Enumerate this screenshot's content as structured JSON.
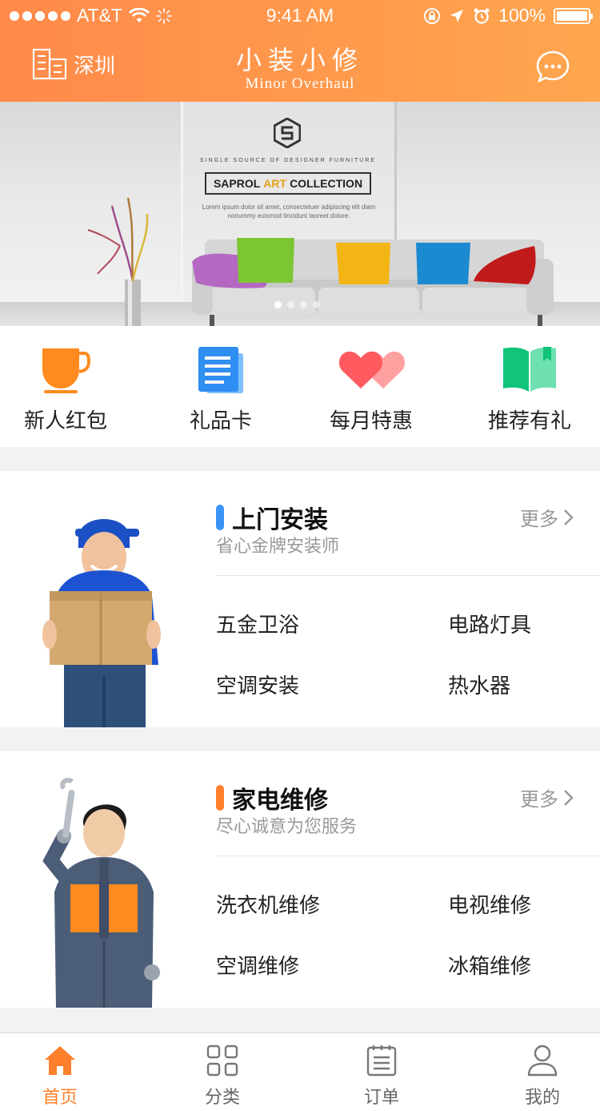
{
  "status_bar": {
    "carrier": "AT&T",
    "time": "9:41 AM",
    "battery": "100%"
  },
  "header": {
    "city": "深圳",
    "brand_cn": "小装小修",
    "brand_en": "Minor Overhaul",
    "brand_color": "#ff8a4a"
  },
  "banner": {
    "tagline": "SINGLE SOURCE OF DESIGNER FURNITURE",
    "title_pre": "SAPROL",
    "title_accent": "ART",
    "title_post": "COLLECTION",
    "lorem": "Lorem ipsum dolor sit amet, consectetuer adipiscing elit diam nonummy euismod tincidunt laoreet dolore.",
    "page_count": 4,
    "active_page": 1
  },
  "quick_actions": [
    {
      "label": "新人红包",
      "icon": "cup-icon"
    },
    {
      "label": "礼品卡",
      "icon": "document-icon"
    },
    {
      "label": "每月特惠",
      "icon": "hearts-icon"
    },
    {
      "label": "推荐有礼",
      "icon": "book-icon"
    }
  ],
  "install": {
    "title": "上门安装",
    "subtitle": "省心金牌安装师",
    "more": "更多",
    "accent": "#3a93f5",
    "items": [
      "五金卫浴",
      "电路灯具",
      "空调安装",
      "热水器"
    ]
  },
  "repair": {
    "title": "家电维修",
    "subtitle": "尽心诚意为您服务",
    "more": "更多",
    "accent": "#ff7f2a",
    "items": [
      "洗衣机维修",
      "电视维修",
      "空调维修",
      "冰箱维修"
    ]
  },
  "tabs": [
    {
      "label": "首页",
      "icon": "home-icon",
      "active": true
    },
    {
      "label": "分类",
      "icon": "grid-icon",
      "active": false
    },
    {
      "label": "订单",
      "icon": "order-icon",
      "active": false
    },
    {
      "label": "我的",
      "icon": "user-icon",
      "active": false
    }
  ]
}
